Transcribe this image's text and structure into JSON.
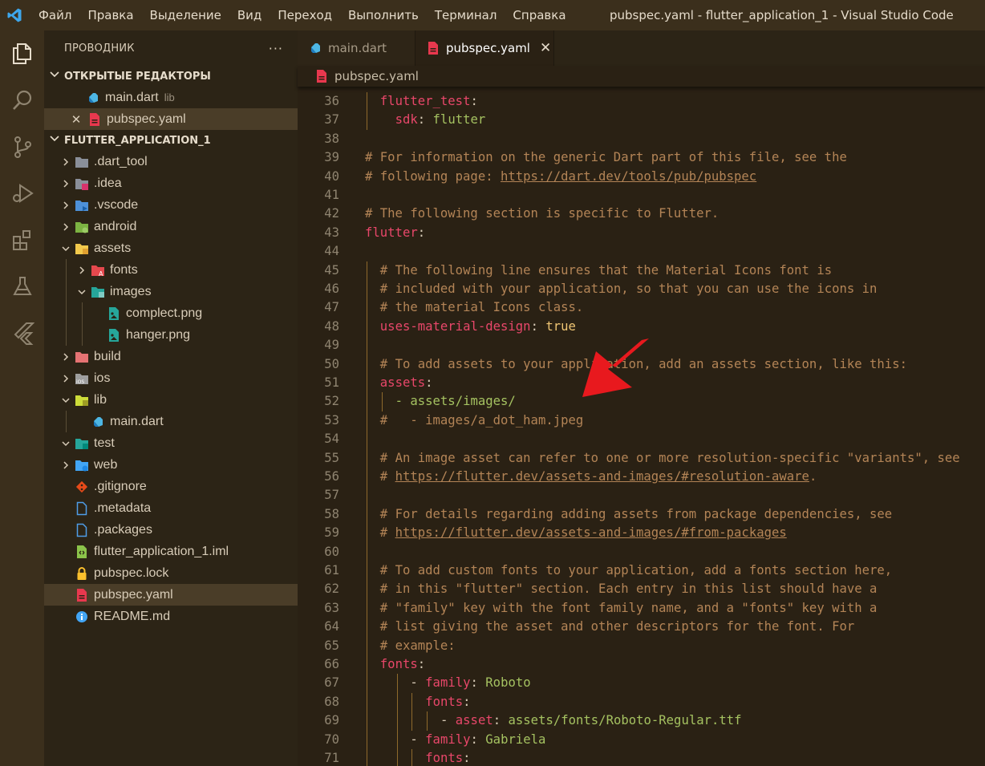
{
  "menu": [
    "Файл",
    "Правка",
    "Выделение",
    "Вид",
    "Переход",
    "Выполнить",
    "Терминал",
    "Справка"
  ],
  "window_title": "pubspec.yaml - flutter_application_1 - Visual Studio Code",
  "activity_bar": [
    "explorer-icon",
    "search-icon",
    "source-control-icon",
    "run-debug-icon",
    "extensions-icon",
    "testing-icon",
    "flutter-icon"
  ],
  "sidebar": {
    "title": "ПРОВОДНИК",
    "more": "···",
    "open_editors": {
      "label": "ОТКРЫТЫЕ РЕДАКТОРЫ",
      "items": [
        {
          "name": "main.dart",
          "desc": "lib"
        },
        {
          "name": "pubspec.yaml",
          "close": "✕"
        }
      ]
    },
    "project": {
      "label": "FLUTTER_APPLICATION_1",
      "items": [
        {
          "name": ".dart_tool"
        },
        {
          "name": ".idea"
        },
        {
          "name": ".vscode"
        },
        {
          "name": "android"
        },
        {
          "name": "assets"
        },
        {
          "name": "fonts"
        },
        {
          "name": "images"
        },
        {
          "name": "complect.png"
        },
        {
          "name": "hanger.png"
        },
        {
          "name": "build"
        },
        {
          "name": "ios"
        },
        {
          "name": "lib"
        },
        {
          "name": "main.dart"
        },
        {
          "name": "test"
        },
        {
          "name": "web"
        },
        {
          "name": ".gitignore"
        },
        {
          "name": ".metadata"
        },
        {
          "name": ".packages"
        },
        {
          "name": "flutter_application_1.iml"
        },
        {
          "name": "pubspec.lock"
        },
        {
          "name": "pubspec.yaml"
        },
        {
          "name": "README.md"
        }
      ]
    }
  },
  "tabs": [
    {
      "label": "main.dart"
    },
    {
      "label": "pubspec.yaml",
      "close": "✕"
    }
  ],
  "breadcrumb": "pubspec.yaml",
  "code_lines": [
    {
      "n": "36",
      "parts": [
        [
          "flutter_test",
          "key"
        ],
        [
          ":",
          "punct"
        ]
      ]
    },
    {
      "n": "37",
      "parts": [
        [
          "sdk",
          "key"
        ],
        [
          ": ",
          "punct"
        ],
        [
          "flutter",
          "val"
        ]
      ]
    },
    {
      "n": "38",
      "parts": []
    },
    {
      "n": "39",
      "parts": [
        [
          "# For information on the generic Dart part of this file, see the",
          "com"
        ]
      ]
    },
    {
      "n": "40",
      "parts": [
        [
          "# following page: ",
          "com"
        ],
        [
          "https://dart.dev/tools/pub/pubspec",
          "link"
        ]
      ]
    },
    {
      "n": "41",
      "parts": []
    },
    {
      "n": "42",
      "parts": [
        [
          "# The following section is specific to Flutter.",
          "com"
        ]
      ]
    },
    {
      "n": "43",
      "parts": [
        [
          "flutter",
          "key"
        ],
        [
          ":",
          "punct"
        ]
      ]
    },
    {
      "n": "44",
      "parts": []
    },
    {
      "n": "45",
      "parts": [
        [
          "# The following line ensures that the Material Icons font is",
          "com"
        ]
      ]
    },
    {
      "n": "46",
      "parts": [
        [
          "# included with your application, so that you can use the icons in",
          "com"
        ]
      ]
    },
    {
      "n": "47",
      "parts": [
        [
          "# the material Icons class.",
          "com"
        ]
      ]
    },
    {
      "n": "48",
      "parts": [
        [
          "uses-material-design",
          "key"
        ],
        [
          ": ",
          "punct"
        ],
        [
          "true",
          "bool"
        ]
      ]
    },
    {
      "n": "49",
      "parts": []
    },
    {
      "n": "50",
      "parts": [
        [
          "# To add assets to your application, add an assets section, like this:",
          "com"
        ]
      ]
    },
    {
      "n": "51",
      "parts": [
        [
          "assets",
          "key"
        ],
        [
          ":",
          "punct"
        ]
      ]
    },
    {
      "n": "52",
      "parts": [
        [
          "- assets/images/",
          "val"
        ]
      ]
    },
    {
      "n": "53",
      "parts": [
        [
          "#   - images/a_dot_ham.jpeg",
          "com"
        ]
      ]
    },
    {
      "n": "54",
      "parts": []
    },
    {
      "n": "55",
      "parts": [
        [
          "# An image asset can refer to one or more resolution-specific \"variants\", see",
          "com"
        ]
      ]
    },
    {
      "n": "56",
      "parts": [
        [
          "# ",
          "com"
        ],
        [
          "https://flutter.dev/assets-and-images/#resolution-aware",
          "link"
        ],
        [
          ".",
          "com"
        ]
      ]
    },
    {
      "n": "57",
      "parts": []
    },
    {
      "n": "58",
      "parts": [
        [
          "# For details regarding adding assets from package dependencies, see",
          "com"
        ]
      ]
    },
    {
      "n": "59",
      "parts": [
        [
          "# ",
          "com"
        ],
        [
          "https://flutter.dev/assets-and-images/#from-packages",
          "link"
        ]
      ]
    },
    {
      "n": "60",
      "parts": []
    },
    {
      "n": "61",
      "parts": [
        [
          "# To add custom fonts to your application, add a fonts section here,",
          "com"
        ]
      ]
    },
    {
      "n": "62",
      "parts": [
        [
          "# in this \"flutter\" section. Each entry in this list should have a",
          "com"
        ]
      ]
    },
    {
      "n": "63",
      "parts": [
        [
          "# \"family\" key with the font family name, and a \"fonts\" key with a",
          "com"
        ]
      ]
    },
    {
      "n": "64",
      "parts": [
        [
          "# list giving the asset and other descriptors for the font. For",
          "com"
        ]
      ]
    },
    {
      "n": "65",
      "parts": [
        [
          "# example:",
          "com"
        ]
      ]
    },
    {
      "n": "66",
      "parts": [
        [
          "fonts",
          "key"
        ],
        [
          ":",
          "punct"
        ]
      ]
    },
    {
      "n": "67",
      "parts": [
        [
          "- ",
          "punct"
        ],
        [
          "family",
          "key"
        ],
        [
          ": ",
          "punct"
        ],
        [
          "Roboto",
          "val"
        ]
      ]
    },
    {
      "n": "68",
      "parts": [
        [
          "fonts",
          "key"
        ],
        [
          ":",
          "punct"
        ]
      ]
    },
    {
      "n": "69",
      "parts": [
        [
          "- ",
          "punct"
        ],
        [
          "asset",
          "key"
        ],
        [
          ": ",
          "punct"
        ],
        [
          "assets/fonts/Roboto-Regular.ttf",
          "val"
        ]
      ]
    },
    {
      "n": "70",
      "parts": [
        [
          "- ",
          "punct"
        ],
        [
          "family",
          "key"
        ],
        [
          ": ",
          "punct"
        ],
        [
          "Gabriela",
          "val"
        ]
      ]
    },
    {
      "n": "71",
      "parts": [
        [
          "fonts",
          "key"
        ],
        [
          ":",
          "punct"
        ]
      ]
    }
  ],
  "colors": {
    "comment": "#b38456",
    "key": "#e8476a",
    "value": "#a5c261",
    "boolean": "#f0c674",
    "annotation_arrow": "#e8191e"
  }
}
